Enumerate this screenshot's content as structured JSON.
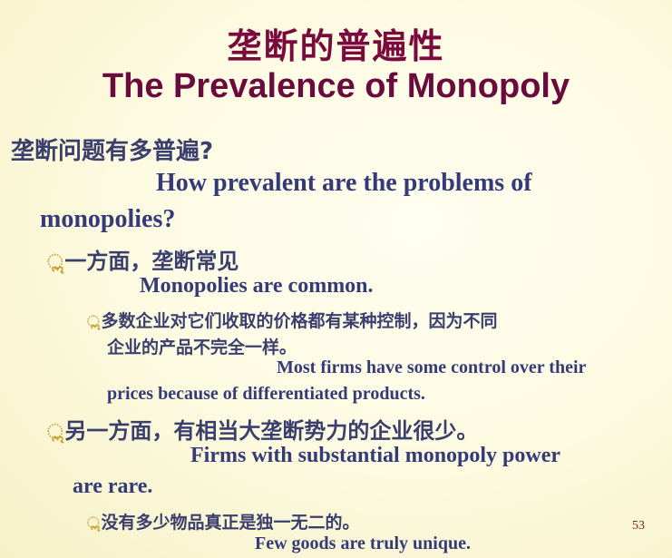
{
  "slide": {
    "title_cn": "垄断的普遍性",
    "title_en": "The Prevalence of Monopoly",
    "page_number": "53"
  },
  "content": {
    "q_cn": "垄断问题有多普遍?",
    "q_en_1": "How prevalent are the problems of",
    "q_en_2": "monopolies?",
    "b1": {
      "cn": "一方面，垄断常见",
      "en": "Monopolies are common.",
      "sub": {
        "cn_1": "多数企业对它们收取的价格都有某种控制，因为不同",
        "cn_2": "企业的产品不完全一样。",
        "en_1": "Most firms have some control over their",
        "en_2": "prices because of differentiated products."
      }
    },
    "b2": {
      "cn": "另一方面，有相当大垄断势力的企业很少。",
      "en_1": "Firms with substantial monopoly power",
      "en_2": "are rare.",
      "sub": {
        "cn": "没有多少物品真正是独一无二的。",
        "en": "Few goods are truly unique."
      }
    },
    "bullet_glyph": "ೢ"
  }
}
